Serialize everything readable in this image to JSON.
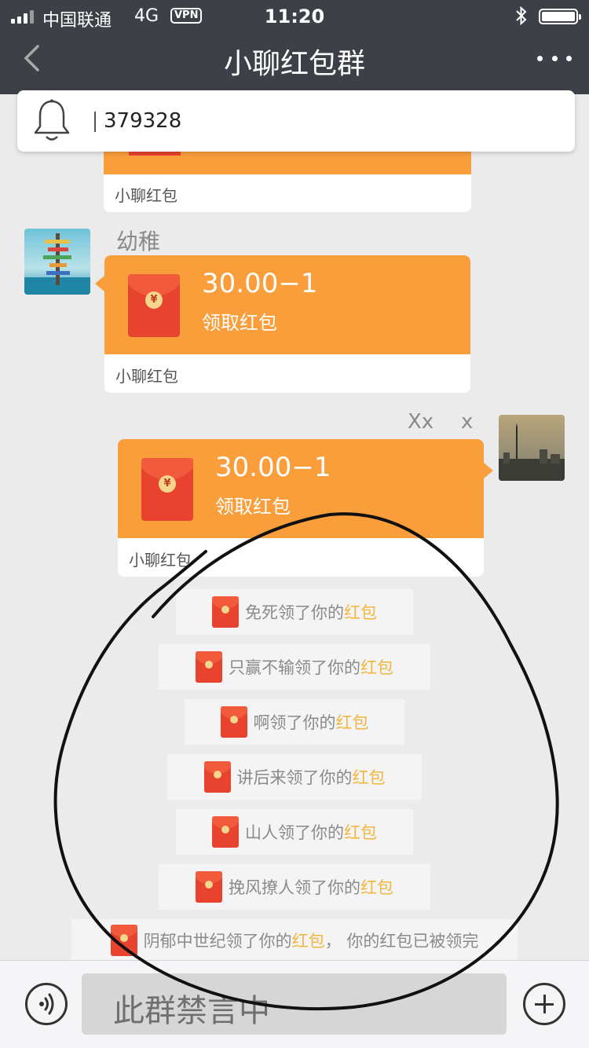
{
  "status_bar": {
    "carrier": "中国联通",
    "network": "4G",
    "vpn": "VPN",
    "time": "11:20"
  },
  "nav": {
    "title": "小聊红包群"
  },
  "notice": {
    "text": "379328"
  },
  "messages": {
    "stub_card_footer": "小聊红包",
    "msg1": {
      "sender": "幼稚",
      "amount": "30.00−1",
      "claim_label": "领取红包",
      "footer": "小聊红包"
    },
    "msg2": {
      "nickname_1": "Xx",
      "nickname_2": "x",
      "amount": "30.00−1",
      "claim_label": "领取红包",
      "footer": "小聊红包"
    }
  },
  "system_notices": [
    {
      "name": "免死",
      "verb": "领了你的",
      "link": "红包"
    },
    {
      "name": "只赢不输",
      "verb": "领了你的",
      "link": "红包"
    },
    {
      "name": "啊",
      "verb": "领了你的",
      "link": "红包"
    },
    {
      "name": "讲后来",
      "verb": "领了你的",
      "link": "红包"
    },
    {
      "name": "山人",
      "verb": "领了你的",
      "link": "红包"
    },
    {
      "name": "挽风撩人",
      "verb": "领了你的",
      "link": "红包"
    },
    {
      "name": "阴郁中世纪",
      "verb": "领了你的",
      "link": "红包",
      "suffix": "， 你的红包已被领完"
    }
  ],
  "input_bar": {
    "muted_text": "此群禁言中"
  },
  "colors": {
    "nav_bg": "#3d4046",
    "red_packet_orange": "#fa9d3b",
    "envelope_red": "#e8432f",
    "link_yellow": "#f2b640",
    "chat_bg": "#ebebeb"
  },
  "icons": [
    "signal-icon",
    "bluetooth-icon",
    "battery-icon",
    "back-chevron-icon",
    "more-dots-icon",
    "bell-icon",
    "red-envelope-icon",
    "voice-icon",
    "plus-icon"
  ]
}
